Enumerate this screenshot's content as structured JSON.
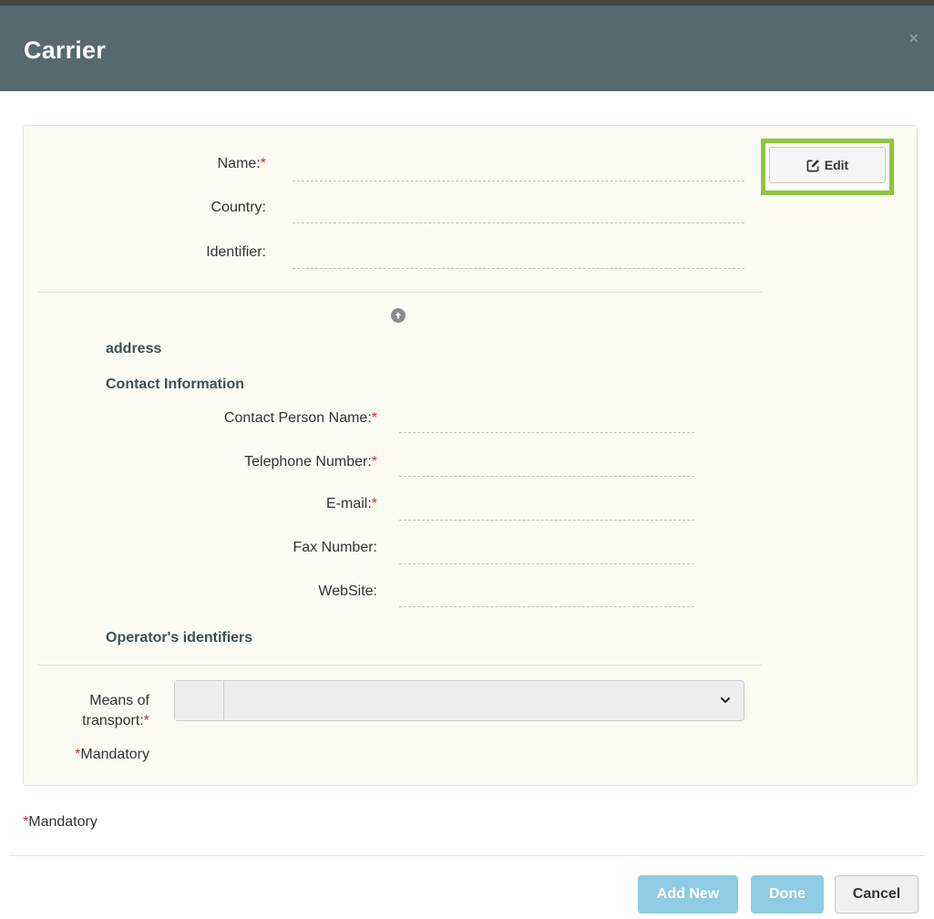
{
  "dialog": {
    "title": "Carrier",
    "close_glyph": "×"
  },
  "identity": {
    "name_label": "Name:",
    "country_label": "Country:",
    "identifier_label": "Identifier:",
    "required_marker": "*",
    "edit_label": "Edit",
    "edit_icon": "edit-icon"
  },
  "address": {
    "collapse_icon": "arrow-up-circle-icon",
    "heading": "address"
  },
  "contact": {
    "heading": "Contact Information",
    "person_label": "Contact Person Name:",
    "phone_label": "Telephone Number:",
    "email_label": "E-mail:",
    "fax_label": "Fax Number:",
    "website_label": "WebSite:"
  },
  "operator": {
    "heading": "Operator's identifiers"
  },
  "transport": {
    "label_line1": "Means of",
    "label_line2": "transport:",
    "selected_value": "",
    "inner_mandatory": "Mandatory"
  },
  "footer": {
    "mandatory": "Mandatory",
    "add_new": "Add New",
    "done": "Done",
    "cancel": "Cancel"
  },
  "colors": {
    "header_bg": "#56696f",
    "highlight": "#8cc63f",
    "required": "#d9222a",
    "primary_disabled": "#8fcbe3"
  }
}
